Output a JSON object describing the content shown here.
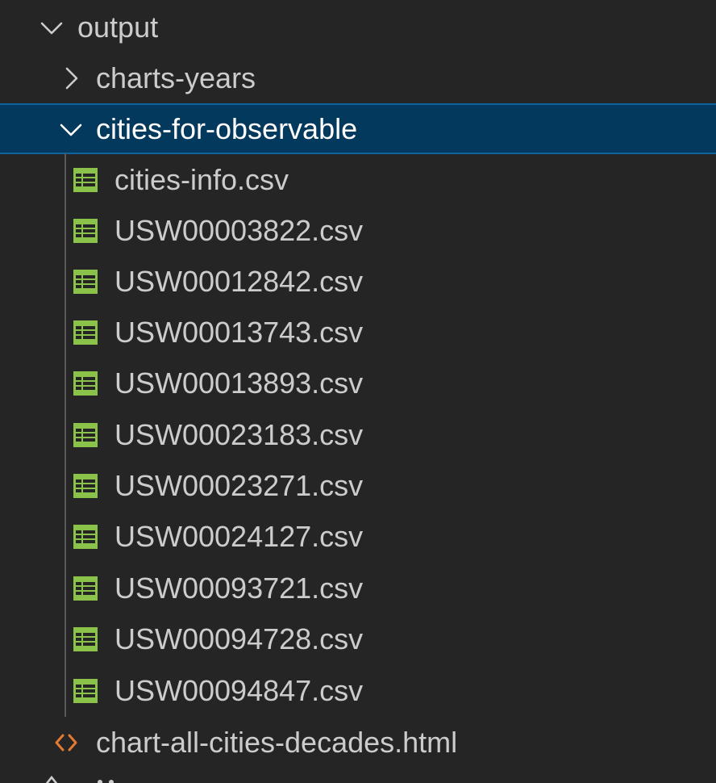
{
  "explorer": {
    "folder_output": "output",
    "folder_charts_years": "charts-years",
    "folder_cities": "cities-for-observable",
    "files": [
      "cities-info.csv",
      "USW00003822.csv",
      "USW00012842.csv",
      "USW00013743.csv",
      "USW00013893.csv",
      "USW00023183.csv",
      "USW00023271.csv",
      "USW00024127.csv",
      "USW00093721.csv",
      "USW00094728.csv",
      "USW00094847.csv"
    ],
    "html_file": "chart-all-cities-decades.html"
  },
  "icons": {
    "folder_expanded": "chevron-down-icon",
    "folder_collapsed": "chevron-right-icon",
    "csv_file": "table-icon",
    "html_file": "code-brackets-icon"
  },
  "colors": {
    "background": "#252526",
    "text": "#cccccc",
    "selected_bg": "#04395e",
    "selected_border": "#0e639c",
    "csv_icon": "#8bc34a",
    "html_icon": "#e37933"
  }
}
